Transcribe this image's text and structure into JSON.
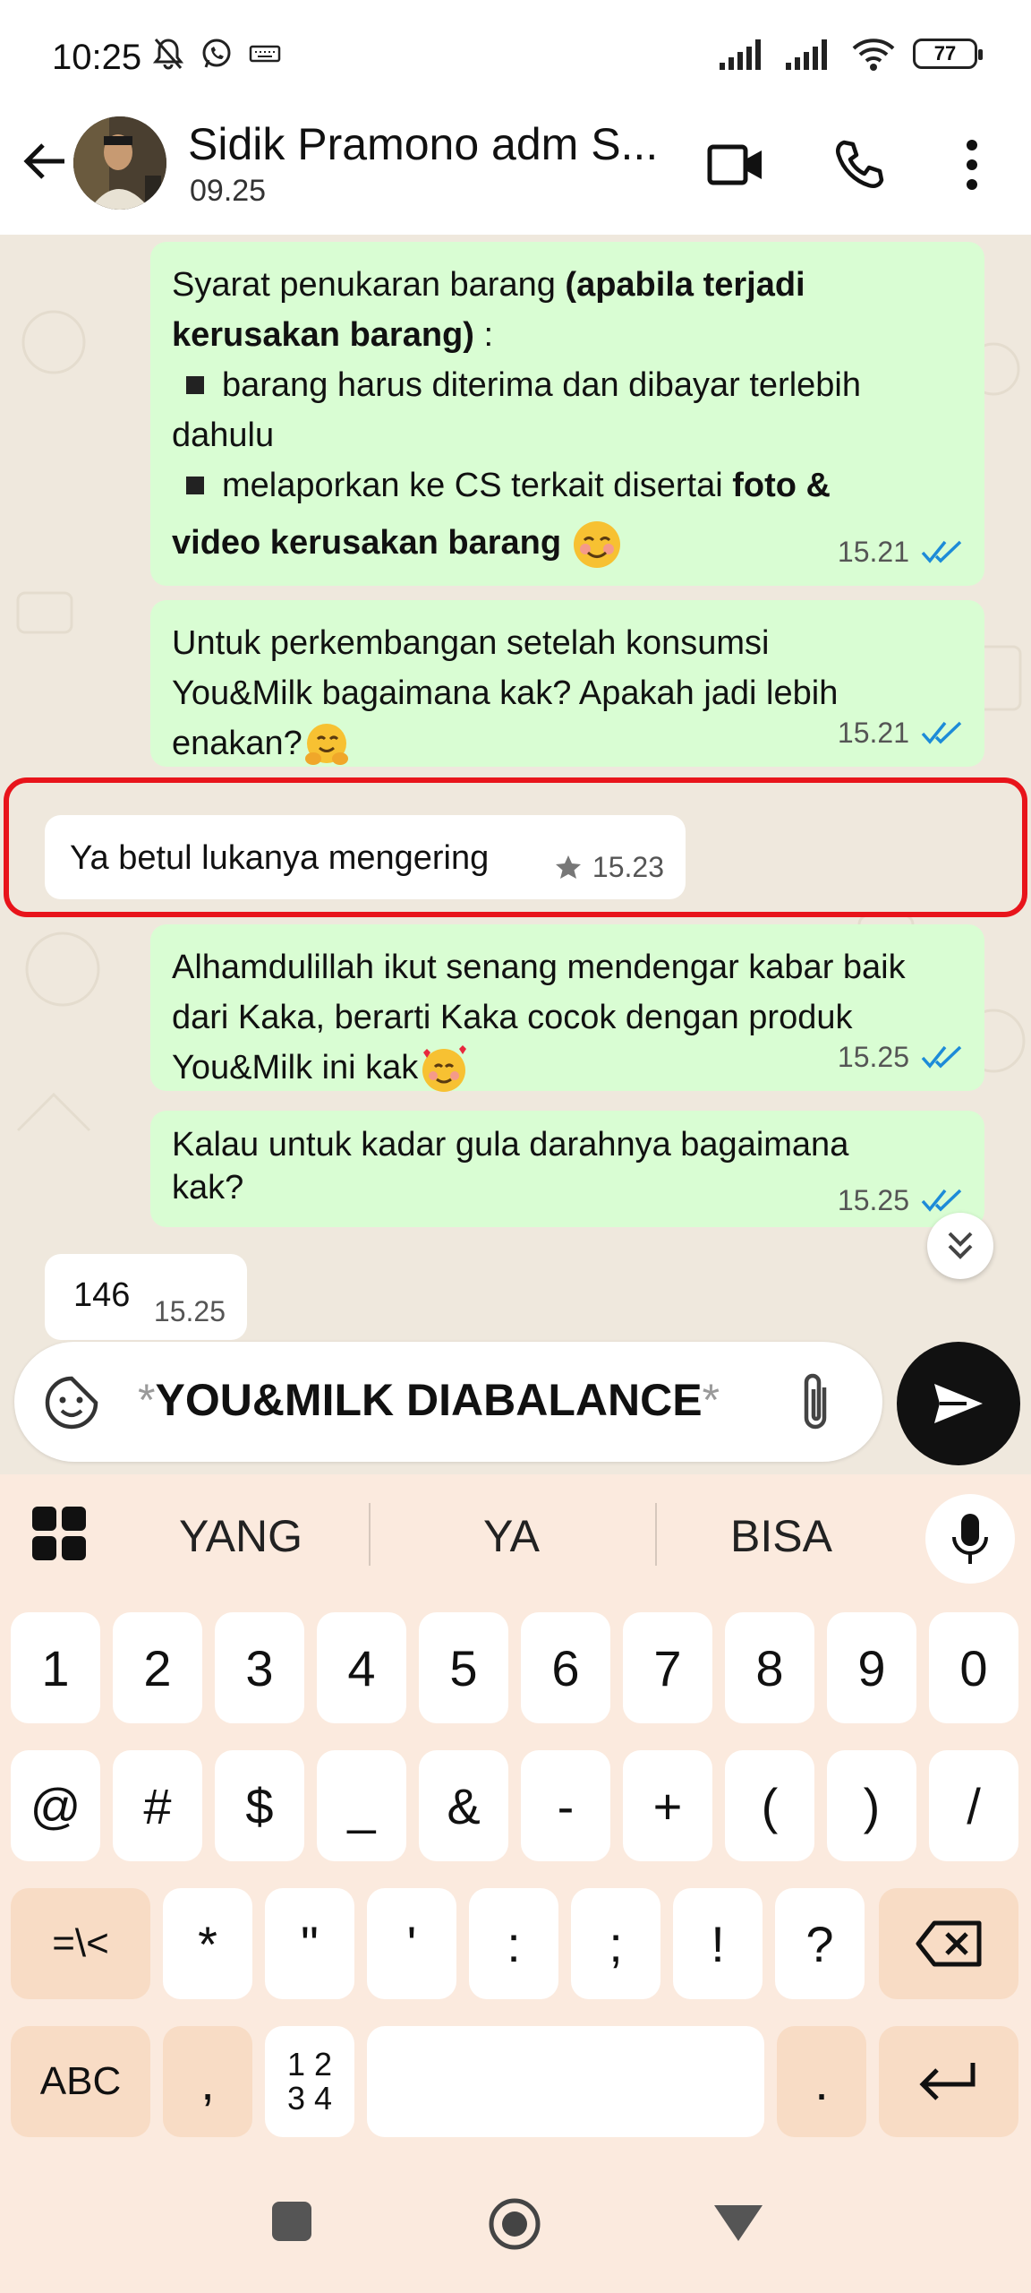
{
  "status_bar": {
    "time": "10:25",
    "battery": "77"
  },
  "header": {
    "contact_name": "Sidik Pramono adm S...",
    "last_seen": "09.25"
  },
  "messages": [
    {
      "direction": "outgoing",
      "line1_plain": "Syarat penukaran barang ",
      "line1_bold": "(apabila terjadi",
      "line2_bold": "kerusakan barang)",
      "line2_plain": " :",
      "bullet1": "barang harus diterima dan dibayar terlebih",
      "bullet1_cont": "dahulu",
      "bullet2_plain": "melaporkan ke CS terkait disertai ",
      "bullet2_bold": "foto &",
      "line_last_bold": "video kerusakan barang",
      "time": "15.21"
    },
    {
      "direction": "outgoing",
      "line1": "Untuk perkembangan setelah konsumsi",
      "line2": "You&Milk bagaimana kak? Apakah jadi lebih",
      "line3": "enakan?",
      "time": "15.21"
    },
    {
      "direction": "incoming",
      "text": "Ya betul lukanya mengering",
      "time": "15.23",
      "starred": true
    },
    {
      "direction": "outgoing",
      "line1": "Alhamdulillah ikut senang mendengar kabar baik",
      "line2": "dari Kaka, berarti Kaka cocok dengan produk",
      "line3": "You&Milk ini kak",
      "time": "15.25"
    },
    {
      "direction": "outgoing",
      "line1": "Kalau untuk kadar gula darahnya bagaimana",
      "line2": "kak?",
      "time": "15.25"
    },
    {
      "direction": "incoming",
      "text": "146",
      "time": "15.25"
    }
  ],
  "composer": {
    "star_open": "*",
    "text": "YOU&MILK DIABALANCE",
    "star_close": "*"
  },
  "keyboard": {
    "suggestions": [
      "YANG",
      "YA",
      "BISA"
    ],
    "row1": [
      "1",
      "2",
      "3",
      "4",
      "5",
      "6",
      "7",
      "8",
      "9",
      "0"
    ],
    "row2": [
      "@",
      "#",
      "$",
      "_",
      "&",
      "-",
      "+",
      "(",
      ")",
      "/"
    ],
    "row3": [
      "=\\<",
      "*",
      "\"",
      "'",
      ":",
      ";",
      "!",
      "?"
    ],
    "abc_label": "ABC",
    "comma": ",",
    "numpad_top": "1 2",
    "numpad_bottom": "3 4",
    "period": "."
  },
  "colors": {
    "outgoing_bubble": "#d9fdd3",
    "incoming_bubble": "#ffffff",
    "chat_background": "#efe8dd",
    "read_ticks": "#1d8bd8",
    "highlight_box": "#e8141b",
    "keyboard_background": "#fbeade"
  }
}
